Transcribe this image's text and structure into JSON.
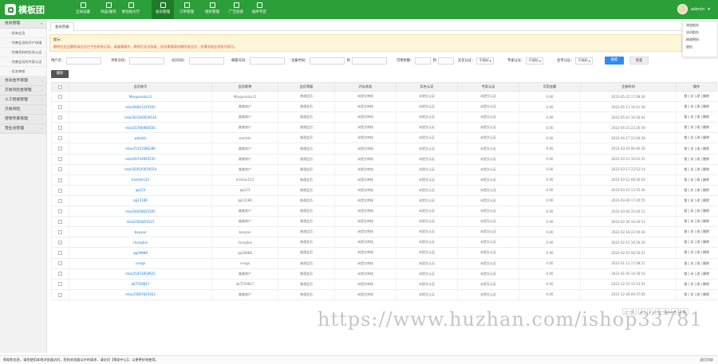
{
  "brand": {
    "name": "模板团"
  },
  "colors": {
    "primary": "#2d9f3a",
    "button": "#2e8ded",
    "notice_red": "#e64a3b"
  },
  "nav": [
    {
      "label": "全局设置",
      "icon": "grid-icon"
    },
    {
      "label": "商品/服务",
      "icon": "user-icon"
    },
    {
      "label": "委任拍大厅",
      "icon": "hall-icon"
    },
    {
      "label": "会员管理",
      "icon": "book-icon",
      "active": true
    },
    {
      "label": "订单管理",
      "icon": "doc-icon"
    },
    {
      "label": "组织管理",
      "icon": "org-icon"
    },
    {
      "label": "广告投放",
      "icon": "ad-icon"
    },
    {
      "label": "插件专区",
      "icon": "plugin-icon"
    }
  ],
  "user": {
    "name": "admin"
  },
  "user_menu": [
    "浏览前台",
    "访问前台",
    "修改密码",
    "退出"
  ],
  "sidebar": {
    "groups": [
      {
        "label": "会员管理",
        "items": [
          "所有会员",
          "完善会员的开户申请",
          "完善资料的实名认证",
          "完善会员的专家认证",
          "实名审核"
        ]
      },
      {
        "label": "会员金币管理"
      },
      {
        "label": "交易风险金管理"
      },
      {
        "label": "人工智能管理"
      },
      {
        "label": "交易风险"
      },
      {
        "label": "营销专家管理"
      },
      {
        "label": "营业员管理"
      }
    ]
  },
  "tab": {
    "label": "会员列表"
  },
  "notice": {
    "title": "提示：",
    "text": "删除会员会删除该会员在平台所有记录，请谨慎操作，删除后无法恢复，如无需要请勿删除该会员，仅需冻结会员账号即可。"
  },
  "filters": {
    "username": "用户名：",
    "phone": "手机号码：",
    "qq": "QQ号码：",
    "email": "邮箱号码：",
    "time": "注册时间：",
    "to": "到",
    "deposit": "可用余额：",
    "realname": "实名认证：",
    "expert": "专家认证：",
    "gold": "金币认证：",
    "select_default": "不限制",
    "search": "搜索",
    "reset": "重置"
  },
  "delete_btn": "删除",
  "table": {
    "headers": [
      "",
      "会员账号",
      "会员昵称",
      "会员等级",
      "开店状态",
      "实名认证",
      "专家认证",
      "可用金额",
      "注册时间",
      "操作"
    ],
    "rows": [
      [
        "Margumata.t2",
        "Margumata.t2",
        "普通会员",
        "未提交审核",
        "未提交认证",
        "未提交认证",
        "0.00",
        "2022-05-25 17:08:36",
        "锁 | 详 | 改 | 删除"
      ],
      [
        "mlas56841245505",
        "美美商户",
        "普通会员",
        "未提交审核",
        "未提交认证",
        "未提交认证",
        "0.00",
        "2022-05-11 16:41:58",
        "锁 | 详 | 改 | 删除"
      ],
      [
        "mlas561564659516",
        "美美商户",
        "普通会员",
        "未提交审核",
        "未提交认证",
        "未提交认证",
        "0.00",
        "2022-05-01 16:56:04",
        "锁 | 详 | 改 | 删除"
      ],
      [
        "mlas55786985656",
        "美美商户",
        "普通会员",
        "未提交审核",
        "未提交认证",
        "未提交认证",
        "0.00",
        "2022-04-21 22:26:59",
        "锁 | 详 | 改 | 删除"
      ],
      [
        "waldskl",
        "waldskl",
        "普通会员",
        "未提交审核",
        "未提交认证",
        "未提交认证",
        "0.00",
        "2022-04-17 22:06:28",
        "锁 | 详 | 改 | 删除"
      ],
      [
        "mlas15151586286",
        "美美商户",
        "普通会员",
        "未提交审核",
        "未提交认证",
        "未提交认证",
        "0.00",
        "2022-03-24 06:46:36",
        "锁 | 详 | 改 | 删除"
      ],
      [
        "mlas56744945535",
        "美美商户",
        "普通会员",
        "未提交审核",
        "未提交认证",
        "未提交认证",
        "0.00",
        "2022-03-21 16:01:55",
        "锁 | 详 | 改 | 删除"
      ],
      [
        "mlas564545659554",
        "美美商户",
        "普通会员",
        "未提交审核",
        "未提交认证",
        "未提交认证",
        "0.00",
        "2022-03-17 23:52:14",
        "锁 | 详 | 改 | 删除"
      ],
      [
        "hashan123",
        "hashan123",
        "普通会员",
        "未提交审核",
        "未提交认证",
        "未提交认证",
        "0.00",
        "2022-03-12 08:26:54",
        "锁 | 详 | 改 | 删除"
      ],
      [
        "qq123",
        "qq123",
        "普通会员",
        "未提交审核",
        "未提交认证",
        "未提交认证",
        "0.00",
        "2022-03-10 13:35:36",
        "锁 | 详 | 改 | 删除"
      ],
      [
        "qq12186",
        "qq12186",
        "普通会员",
        "未提交审核",
        "未提交认证",
        "未提交认证",
        "0.00",
        "2022-03-06 17:20:55",
        "锁 | 详 | 改 | 删除"
      ],
      [
        "mlas56458625565",
        "美美商户",
        "普通会员",
        "未提交审核",
        "未提交认证",
        "未提交认证",
        "0.00",
        "2022-03-04 15:40:11",
        "锁 | 详 | 改 | 删除"
      ],
      [
        "mlas5565855515",
        "美美商户",
        "普通会员",
        "未提交审核",
        "未提交认证",
        "未提交认证",
        "0.00",
        "2022-02-26 19:30:51",
        "锁 | 详 | 改 | 删除"
      ],
      [
        "baoyan",
        "baoyan",
        "普通会员",
        "未提交审核",
        "未提交认证",
        "未提交认证",
        "0.00",
        "2022-02-18 22:00:30",
        "锁 | 详 | 改 | 删除"
      ],
      [
        "rhanghai",
        "rhanghai",
        "普通会员",
        "未提交审核",
        "未提交认证",
        "未提交认证",
        "0.00",
        "2022-02-15 16:20:30",
        "锁 | 详 | 改 | 删除"
      ],
      [
        "qq39888",
        "qq39888",
        "普通会员",
        "未提交审核",
        "未提交认证",
        "未提交认证",
        "0.00",
        "2022-02-03 08:56:31",
        "锁 | 详 | 改 | 删除"
      ],
      [
        "cengo",
        "cengo",
        "普通会员",
        "未提交审核",
        "未提交认证",
        "未提交认证",
        "0.00",
        "2022-01-12 17:08:51",
        "锁 | 详 | 改 | 删除"
      ],
      [
        "mlas55451859625",
        "美美商户",
        "普通会员",
        "未提交审核",
        "未提交认证",
        "未提交认证",
        "0.00",
        "2022-01-05 14:36:54",
        "锁 | 详 | 改 | 删除"
      ],
      [
        "a67559817",
        "a67559817",
        "普通会员",
        "未提交审核",
        "未提交认证",
        "未提交认证",
        "0.00",
        "2021-12-31 15:53:51",
        "锁 | 详 | 改 | 删除"
      ],
      [
        "mlas15687835563",
        "美美商户",
        "普通会员",
        "未提交审核",
        "未提交认证",
        "未提交认证",
        "0.00",
        "2021-12-28 09:37:06",
        "锁 | 详 | 改 | 删除"
      ]
    ]
  },
  "pager": {
    "items": [
      "上一页",
      "1",
      "2",
      "下一页"
    ],
    "total": "共 12 条"
  },
  "watermark": "https://www.huzhan.com/ishop33781",
  "statusbar": {
    "left": "帮助和信息，请您使用本地浏览器访问，您的浏览器以外的请求，请访问【帮助中心】，以便更好地使用。",
    "right": "返回顶部"
  }
}
